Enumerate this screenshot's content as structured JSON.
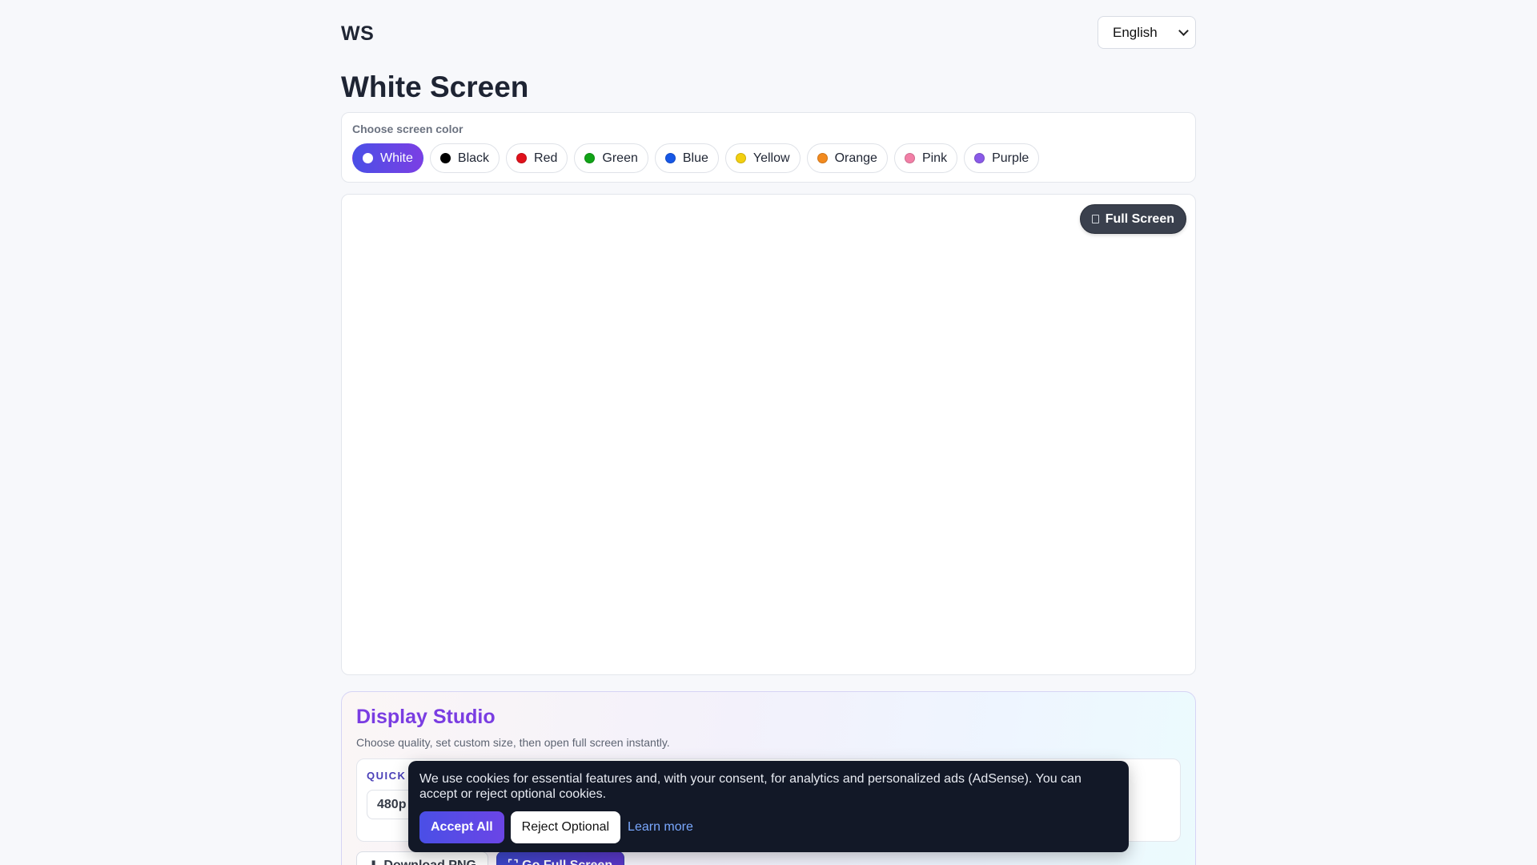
{
  "header": {
    "logo": "WS",
    "language": "English"
  },
  "page": {
    "title": "White Screen"
  },
  "chooser": {
    "label": "Choose screen color",
    "active": "White",
    "colors": [
      {
        "label": "White",
        "hex": "#ffffff"
      },
      {
        "label": "Black",
        "hex": "#000000"
      },
      {
        "label": "Red",
        "hex": "#e0111b"
      },
      {
        "label": "Green",
        "hex": "#10a316"
      },
      {
        "label": "Blue",
        "hex": "#1657e6"
      },
      {
        "label": "Yellow",
        "hex": "#f2cf10"
      },
      {
        "label": "Orange",
        "hex": "#f28a1e"
      },
      {
        "label": "Pink",
        "hex": "#f27fa6"
      },
      {
        "label": "Purple",
        "hex": "#8a5ae8"
      }
    ]
  },
  "preview": {
    "background": "#ffffff",
    "fullscreen_label": "Full Screen"
  },
  "studio": {
    "title": "Display Studio",
    "subtitle": "Choose quality, set custom size, then open full screen instantly.",
    "quick_label": "QUICK",
    "quick_option": "480p",
    "download_label": "Download PNG",
    "go_fullscreen_label": "Go Full Screen"
  },
  "cookie": {
    "text": "We use cookies for essential features and, with your consent, for analytics and personalized ads (AdSense). You can accept or reject optional cookies.",
    "accept_label": "Accept All",
    "reject_label": "Reject Optional",
    "learn_more_label": "Learn more"
  },
  "icons": {
    "fullscreen": "fullscreen-icon",
    "download": "download-icon",
    "language_dropdown": "chevron-down-icon"
  }
}
